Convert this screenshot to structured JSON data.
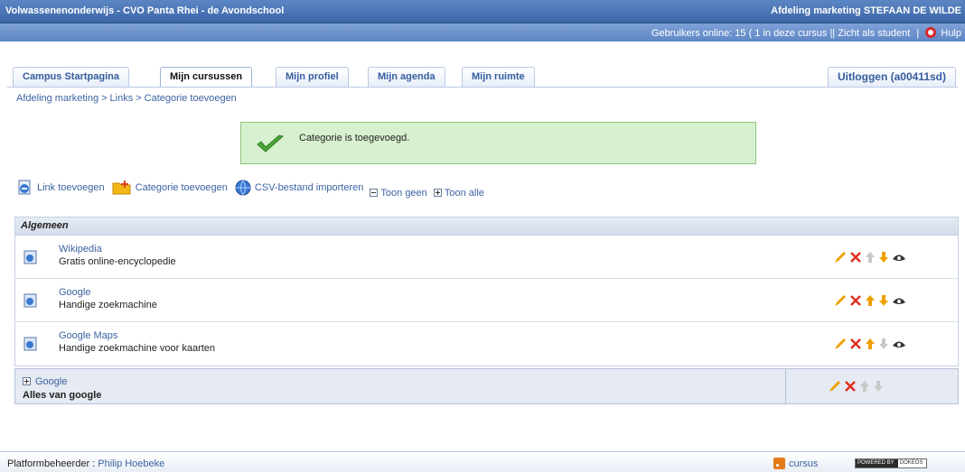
{
  "header": {
    "site_title": "Volwassenenonderwijs - CVO Panta Rhei - de Avondschool",
    "department_user": "Afdeling marketing STEFAAN DE WILDE"
  },
  "subbar": {
    "online_label": "Gebruikers online:",
    "online_count": "15",
    "in_course": "( 1 in deze cursus",
    "view_as_student": "|| Zicht als student",
    "help": "Hulp"
  },
  "tabs": [
    {
      "label": "Campus Startpagina",
      "active": false
    },
    {
      "label": "Mijn cursussen",
      "active": true
    },
    {
      "label": "Mijn profiel",
      "active": false
    },
    {
      "label": "Mijn agenda",
      "active": false
    },
    {
      "label": "Mijn ruimte",
      "active": false
    }
  ],
  "logout_label": "Uitloggen (a00411sd)",
  "breadcrumb": {
    "items": [
      "Afdeling marketing",
      "Links",
      "Categorie toevoegen"
    ]
  },
  "confirmation": {
    "message": "Categorie is toegevoegd."
  },
  "actions": {
    "add_link": "Link toevoegen",
    "add_category": "Categorie toevoegen",
    "import_csv": "CSV-bestand importeren",
    "show_none": "Toon geen",
    "show_all": "Toon alle"
  },
  "category": {
    "name": "Algemeen",
    "links": [
      {
        "title": "Wikipedia",
        "description": "Gratis online-encyclopedie"
      },
      {
        "title": "Google",
        "description": "Handige zoekmachine"
      },
      {
        "title": "Google Maps",
        "description": "Handige zoekmachine voor kaarten"
      }
    ]
  },
  "subcategory": {
    "title": "Google",
    "description": "Alles van google"
  },
  "footer": {
    "admin_label": "Platformbeheerder :",
    "admin_name": "Philip Hoebeke",
    "rss_label": "cursus",
    "powered_left": "POWERED BY",
    "powered_right": "DOKEOS"
  },
  "colors": {
    "header_blue": "#3b65a8",
    "link_blue": "#3c62a2",
    "confirm_green": "#d7f0cf",
    "edit_orange": "#f0a000",
    "delete_red": "#e03020"
  }
}
